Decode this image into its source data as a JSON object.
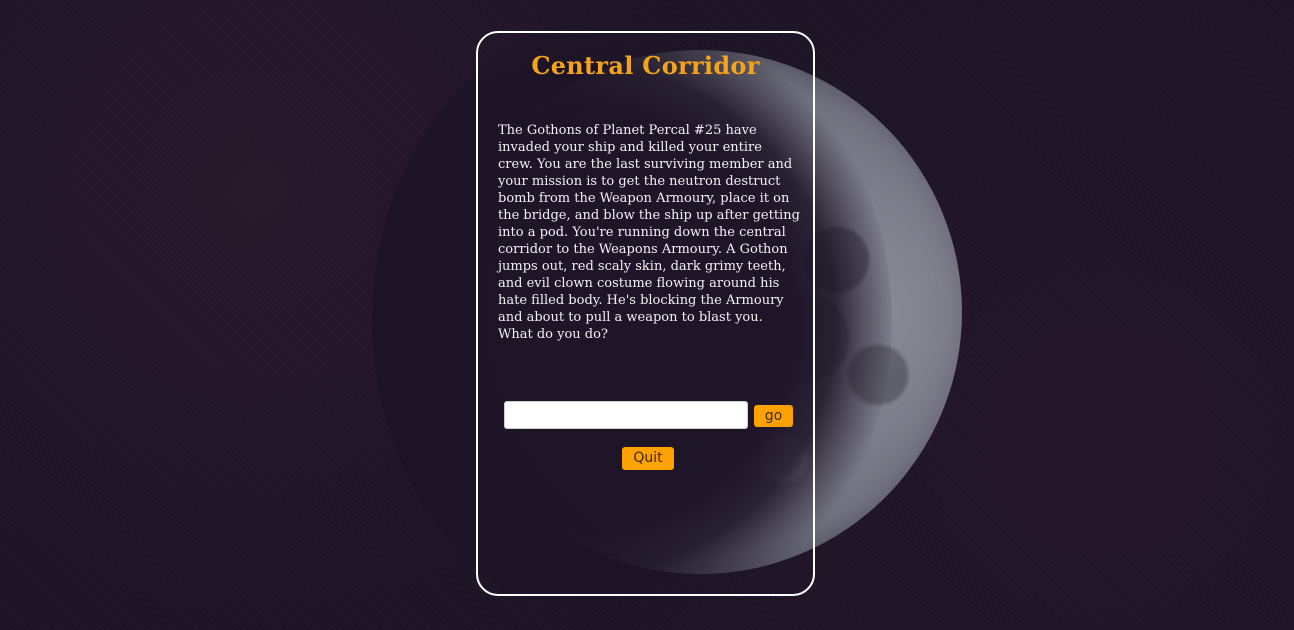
{
  "room": {
    "title": "Central Corridor",
    "description": "The Gothons of Planet Percal #25 have invaded your ship and killed your entire crew. You are the last surviving member and your mission is to get the neutron destruct bomb from the Weapon Armoury, place it on the bridge, and blow the ship up after getting into a pod. You're running down the central corridor to the Weapons Armoury. A Gothon jumps out, red scaly skin, dark grimy teeth, and evil clown costume flowing around his hate filled body. He's blocking the Armoury and about to pull a weapon to blast you. What do you do?"
  },
  "form": {
    "action_value": "",
    "action_placeholder": "",
    "go_label": "go"
  },
  "controls": {
    "quit_label": "Quit"
  },
  "colors": {
    "accent": "#ffa200",
    "title": "#f5a31a",
    "background": "#1c1426",
    "panel_border": "#ffffff",
    "text": "#f2f0f4"
  }
}
